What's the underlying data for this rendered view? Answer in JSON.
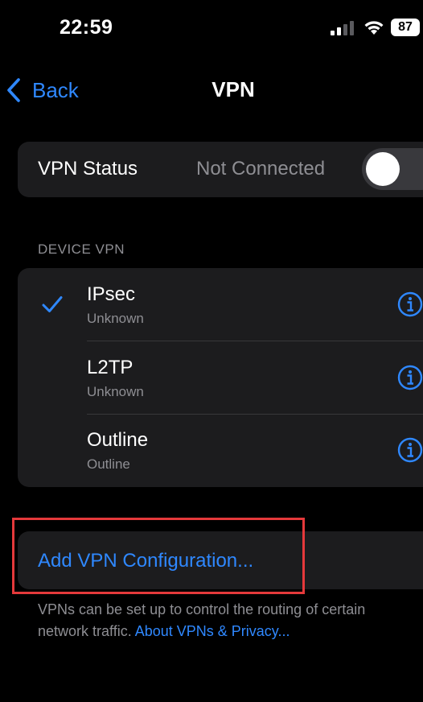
{
  "status_bar": {
    "time": "22:59",
    "battery": "87"
  },
  "nav": {
    "back_label": "Back",
    "title": "VPN"
  },
  "vpn_status": {
    "label": "VPN Status",
    "value": "Not Connected",
    "toggle_on": false
  },
  "device_vpn": {
    "header": "DEVICE VPN",
    "items": [
      {
        "name": "IPsec",
        "subtitle": "Unknown",
        "selected": true
      },
      {
        "name": "L2TP",
        "subtitle": "Unknown",
        "selected": false
      },
      {
        "name": "Outline",
        "subtitle": "Outline",
        "selected": false
      }
    ]
  },
  "add_config": {
    "label": "Add VPN Configuration..."
  },
  "footer": {
    "text": "VPNs can be set up to control the routing of certain network traffic.",
    "link": "About VPNs & Privacy..."
  },
  "colors": {
    "accent": "#2f88ff",
    "background": "#000000",
    "card": "#1c1c1e",
    "secondary_text": "#8e8e93",
    "highlight": "#e5393b"
  },
  "icons": {
    "back": "chevron-left-icon",
    "check": "checkmark-icon",
    "info": "info-circle-icon",
    "signal": "cellular-signal-icon",
    "wifi": "wifi-icon",
    "battery": "battery-icon"
  }
}
